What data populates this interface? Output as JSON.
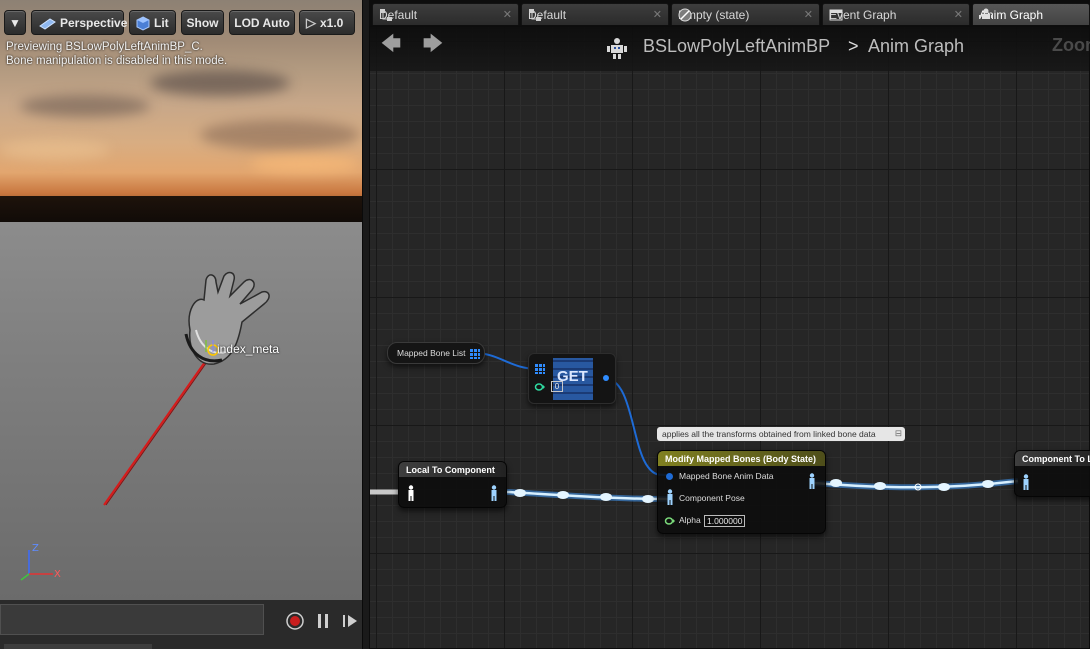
{
  "viewport": {
    "toolbar": {
      "view_mode": "Perspective",
      "lighting": "Lit",
      "show": "Show",
      "lod": "LOD Auto",
      "speed": "x1.0"
    },
    "info_line1": "Previewing BSLowPolyLeftAnimBP_C.",
    "info_line2": "Bone manipulation is disabled in this mode.",
    "bone_label": "index_meta",
    "axes": {
      "z": "Z",
      "x": "X"
    }
  },
  "tabs": [
    {
      "label": "Default",
      "icon": "state-machine-icon",
      "active": false
    },
    {
      "label": "Default",
      "icon": "state-machine-icon",
      "active": false
    },
    {
      "label": "Empty (state)",
      "icon": "state-icon",
      "active": false
    },
    {
      "label": "Event Graph",
      "icon": "event-graph-icon",
      "active": false
    },
    {
      "label": "Anim Graph",
      "icon": "anim-graph-icon",
      "active": true
    }
  ],
  "breadcrumb": {
    "blueprint": "BSLowPolyLeftAnimBP",
    "separator": ">",
    "graph": "Anim Graph"
  },
  "zoom_label": "Zoom",
  "nodes": {
    "mapped_bone_list": {
      "title": "Mapped Bone List"
    },
    "get": {
      "title": "GET",
      "index_value": "0"
    },
    "local_to_component": {
      "title": "Local To Component"
    },
    "modify": {
      "comment": "applies all the transforms obtained from linked bone data",
      "title": "Modify Mapped Bones (Body State)",
      "pin_anim_data": "Mapped Bone Anim Data",
      "pin_pose": "Component Pose",
      "pin_alpha": "Alpha",
      "alpha_value": "1.000000"
    },
    "component_to_local": {
      "title": "Component To Lo"
    }
  },
  "colors": {
    "exec_wire": "#8fd0ff",
    "ref_wire": "#1e6bd6",
    "modify_title": "#808021",
    "pose_pin": "#9ed3ff",
    "bool_pin": "#7ad97a"
  }
}
